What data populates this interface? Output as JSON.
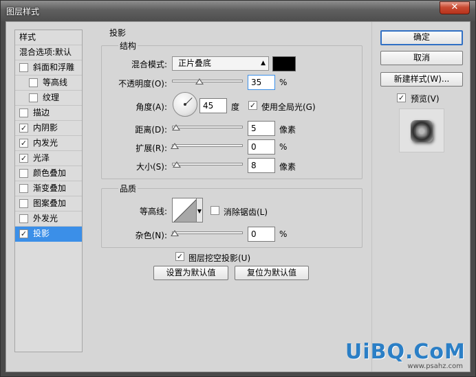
{
  "window": {
    "title": "图层样式",
    "close_glyph": "✕"
  },
  "sidebar": {
    "items": [
      {
        "label": "样式",
        "checkbox": null,
        "checked": false,
        "indent": false,
        "selected": false
      },
      {
        "label": "混合选项:默认",
        "checkbox": null,
        "checked": false,
        "indent": false,
        "selected": false
      },
      {
        "label": "斜面和浮雕",
        "checkbox": true,
        "checked": false,
        "indent": false,
        "selected": false
      },
      {
        "label": "等高线",
        "checkbox": true,
        "checked": false,
        "indent": true,
        "selected": false
      },
      {
        "label": "纹理",
        "checkbox": true,
        "checked": false,
        "indent": true,
        "selected": false
      },
      {
        "label": "描边",
        "checkbox": true,
        "checked": false,
        "indent": false,
        "selected": false
      },
      {
        "label": "内阴影",
        "checkbox": true,
        "checked": true,
        "indent": false,
        "selected": false
      },
      {
        "label": "内发光",
        "checkbox": true,
        "checked": true,
        "indent": false,
        "selected": false
      },
      {
        "label": "光泽",
        "checkbox": true,
        "checked": true,
        "indent": false,
        "selected": false
      },
      {
        "label": "颜色叠加",
        "checkbox": true,
        "checked": false,
        "indent": false,
        "selected": false
      },
      {
        "label": "渐变叠加",
        "checkbox": true,
        "checked": false,
        "indent": false,
        "selected": false
      },
      {
        "label": "图案叠加",
        "checkbox": true,
        "checked": false,
        "indent": false,
        "selected": false
      },
      {
        "label": "外发光",
        "checkbox": true,
        "checked": false,
        "indent": false,
        "selected": false
      },
      {
        "label": "投影",
        "checkbox": true,
        "checked": true,
        "indent": false,
        "selected": true
      }
    ]
  },
  "main": {
    "section_title": "投影",
    "structure": {
      "group_title": "结构",
      "blend_mode_label": "混合模式:",
      "blend_mode_value": "正片叠底",
      "blend_color": "#000000",
      "opacity_label": "不透明度(O):",
      "opacity_value": "35",
      "opacity_unit": "%",
      "opacity_fraction": 0.35,
      "angle_label": "角度(A):",
      "angle_value": "45",
      "angle_unit": "度",
      "global_light_label": "使用全局光(G)",
      "global_light_checked": true,
      "distance_label": "距离(D):",
      "distance_value": "5",
      "distance_unit": "像素",
      "distance_fraction": 0.02,
      "spread_label": "扩展(R):",
      "spread_value": "0",
      "spread_unit": "%",
      "spread_fraction": 0.0,
      "size_label": "大小(S):",
      "size_value": "8",
      "size_unit": "像素",
      "size_fraction": 0.03
    },
    "quality": {
      "group_title": "品质",
      "contour_label": "等高线:",
      "antialias_label": "消除锯齿(L)",
      "antialias_checked": false,
      "noise_label": "杂色(N):",
      "noise_value": "0",
      "noise_unit": "%",
      "noise_fraction": 0.0
    },
    "knockout_label": "图层挖空投影(U)",
    "knockout_checked": true,
    "make_default_label": "设置为默认值",
    "reset_default_label": "复位为默认值"
  },
  "buttons": {
    "ok": "确定",
    "cancel": "取消",
    "new_style": "新建样式(W)...",
    "preview_label": "预览(V)",
    "preview_checked": true
  },
  "watermark": {
    "text": "UiBQ.CoM",
    "sub": "www.psahz.com"
  }
}
